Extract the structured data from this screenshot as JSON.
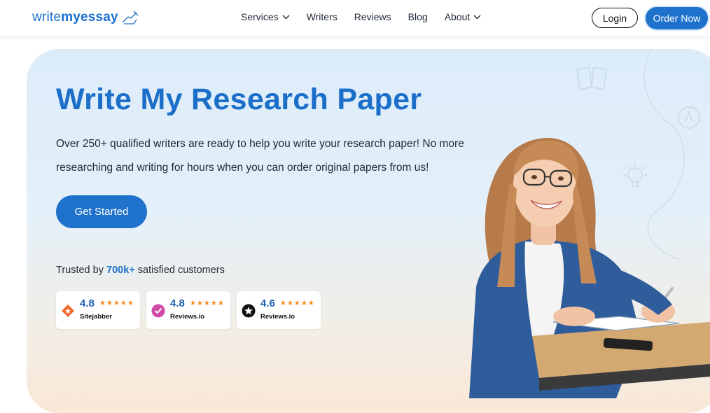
{
  "header": {
    "logo": {
      "part1": "write",
      "part2": "myessay"
    },
    "nav": [
      {
        "label": "Services",
        "has_dropdown": true
      },
      {
        "label": "Writers",
        "has_dropdown": false
      },
      {
        "label": "Reviews",
        "has_dropdown": false
      },
      {
        "label": "Blog",
        "has_dropdown": false
      },
      {
        "label": "About",
        "has_dropdown": true
      }
    ],
    "login_label": "Login",
    "order_label": "Order Now"
  },
  "hero": {
    "title": "Write My Research Paper",
    "description": "Over 250+ qualified writers are ready to help you write your research paper! No more researching and writing for hours when you can order original papers from us!",
    "cta_label": "Get Started",
    "trusted": {
      "prefix": "Trusted by ",
      "count": "700k+",
      "suffix": " satisfied customers"
    },
    "ratings": [
      {
        "score": "4.8",
        "stars": "★★★★★",
        "source": "Sitejabber",
        "icon": "sitejabber-icon",
        "color": "#f26a2e"
      },
      {
        "score": "4.8",
        "stars": "★★★★★",
        "source": "Reviews.io",
        "icon": "reviews-io-check-icon",
        "color": "#d04aa8"
      },
      {
        "score": "4.6",
        "stars": "★★★★★",
        "source": "Reviews.io",
        "icon": "reviews-io-star-icon",
        "color": "#111111"
      }
    ]
  },
  "colors": {
    "brand": "#1f72cc",
    "title": "#1b6fc9",
    "star": "#f28a1c"
  }
}
